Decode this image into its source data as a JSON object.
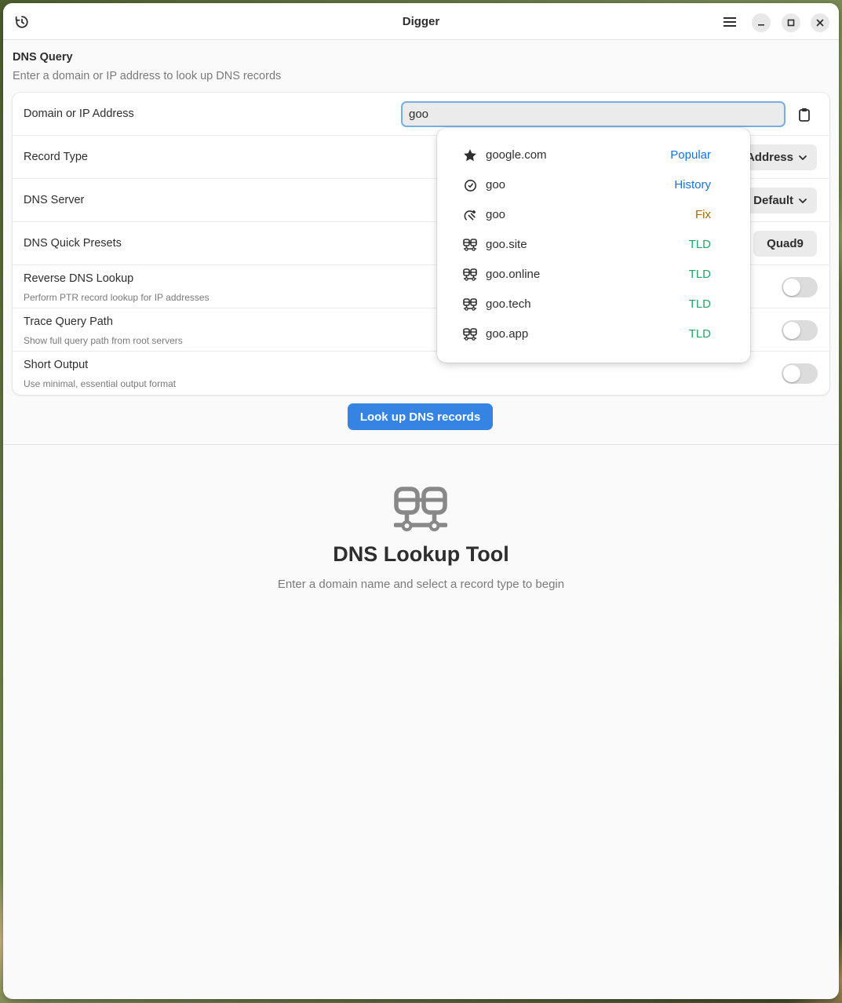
{
  "window": {
    "title": "Digger"
  },
  "query": {
    "section_title": "DNS Query",
    "section_desc": "Enter a domain or IP address to look up DNS records",
    "rows": {
      "domain": {
        "label": "Domain or IP Address",
        "value": "goo"
      },
      "record_type": {
        "label": "Record Type",
        "value": "Address"
      },
      "dns_server": {
        "label": "DNS Server",
        "value": "Default"
      },
      "presets": {
        "label": "DNS Quick Presets",
        "value": "Quad9"
      },
      "reverse": {
        "label": "Reverse DNS Lookup",
        "sub": "Perform PTR record lookup for IP addresses",
        "on": false
      },
      "trace": {
        "label": "Trace Query Path",
        "sub": "Show full query path from root servers",
        "on": false
      },
      "short": {
        "label": "Short Output",
        "sub": "Use minimal, essential output format",
        "on": false
      }
    }
  },
  "suggestions": [
    {
      "icon": "star-icon",
      "text": "google.com",
      "tag": "Popular",
      "tag_color": "#1c71d8"
    },
    {
      "icon": "clock-icon",
      "text": "goo",
      "tag": "History",
      "tag_color": "#1c71d8"
    },
    {
      "icon": "fix-icon",
      "text": "goo",
      "tag": "Fix",
      "tag_color": "#9c6e03"
    },
    {
      "icon": "network-icon",
      "text": "goo.site",
      "tag": "TLD",
      "tag_color": "#26a269"
    },
    {
      "icon": "network-icon",
      "text": "goo.online",
      "tag": "TLD",
      "tag_color": "#26a269"
    },
    {
      "icon": "network-icon",
      "text": "goo.tech",
      "tag": "TLD",
      "tag_color": "#26a269"
    },
    {
      "icon": "network-icon",
      "text": "goo.app",
      "tag": "TLD",
      "tag_color": "#26a269"
    }
  ],
  "lookup_button": "Look up DNS records",
  "status": {
    "title": "DNS Lookup Tool",
    "desc": "Enter a domain name and select a record type to begin"
  }
}
